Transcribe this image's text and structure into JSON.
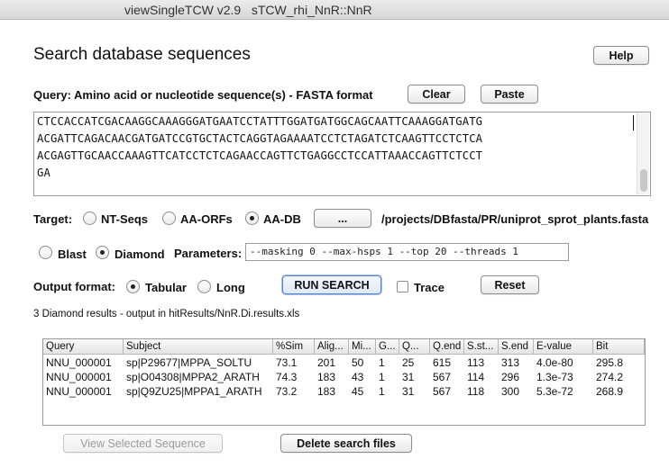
{
  "window": {
    "app": "viewSingleTCW v2.9",
    "project": "sTCW_rhi_NnR::NnR"
  },
  "page_title": "Search database sequences",
  "help_label": "Help",
  "query": {
    "label": "Query: Amino acid or nucleotide sequence(s) - FASTA format",
    "clear_label": "Clear",
    "paste_label": "Paste",
    "lines": [
      "CTCCACCATCGACAAGGCAAAGGGATGAATCCTATTTGGATGATGGCAGCAATTCAAAGGATGATG",
      "ACGATTCAGACAACGATGATCCGTGCTACTCAGGTAGAAAATCCTCTAGATCTCAAGTTCCTCTCA",
      "ACGAGTTGCAACCAAAGTTCATCCTCTCAGAACCAGTTCTGAGGCCTCCATTAAACCAGTTCTCCT",
      "GA"
    ]
  },
  "target": {
    "label": "Target:",
    "options": [
      "NT-Seqs",
      "AA-ORFs",
      "AA-DB"
    ],
    "selected": "AA-DB",
    "browse_label": "...",
    "db_path": "/projects/DBfasta/PR/uniprot_sprot_plants.fasta"
  },
  "program": {
    "options": [
      "Blast",
      "Diamond"
    ],
    "selected": "Diamond",
    "params_label": "Parameters:",
    "params_value": "--masking 0  --max-hsps 1 --top 20 --threads 1"
  },
  "output": {
    "label": "Output format:",
    "options": [
      "Tabular",
      "Long"
    ],
    "selected": "Tabular",
    "run_label": "RUN SEARCH",
    "trace_label": "Trace",
    "trace_checked": false,
    "reset_label": "Reset"
  },
  "status_text": "3 Diamond results - output in hitResults/NnR.Di.results.xls",
  "results": {
    "columns": [
      "Query",
      "Subject",
      "%Sim",
      "Alig...",
      "Mi...",
      "G...",
      "Q...",
      "Q.end",
      "S.st...",
      "S.end",
      "E-value",
      "Bit"
    ],
    "rows": [
      [
        "NNU_000001",
        "sp|P29677|MPPA_SOLTU",
        "73.1",
        "201",
        "50",
        "1",
        "25",
        "615",
        "113",
        "313",
        "4.0e-80",
        "295.8"
      ],
      [
        "NNU_000001",
        "sp|O04308|MPPA2_ARATH",
        "74.3",
        "183",
        "43",
        "1",
        "31",
        "567",
        "114",
        "296",
        "1.3e-73",
        "274.2"
      ],
      [
        "NNU_000001",
        "sp|Q9ZU25|MPPA1_ARATH",
        "73.2",
        "183",
        "45",
        "1",
        "31",
        "567",
        "118",
        "300",
        "5.3e-72",
        "268.9"
      ]
    ]
  },
  "view_selected_label": "View Selected Sequence",
  "delete_files_label": "Delete search files"
}
